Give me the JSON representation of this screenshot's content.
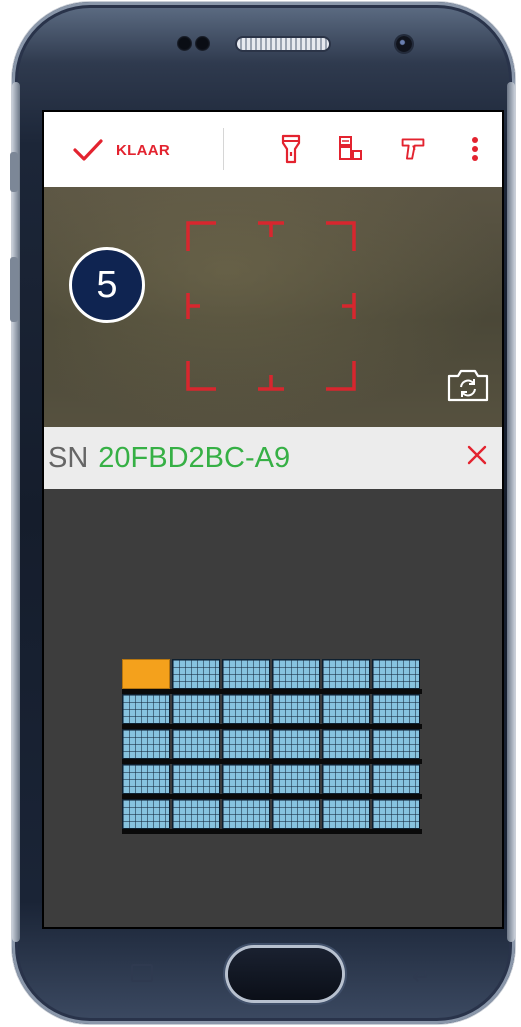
{
  "toolbar": {
    "done_label": "KLAAR",
    "icons": [
      "checkmark-icon",
      "flashlight-icon",
      "scan-mode-icon",
      "barcode-scanner-icon",
      "more-vert-icon"
    ],
    "accent": "#e3232f"
  },
  "viewfinder": {
    "step_number": "5",
    "frame_color": "#d8262e"
  },
  "serial": {
    "prefix": "SN",
    "value": "20FBD2BC-A9",
    "value_color": "#36b045"
  },
  "panel_layout": {
    "rows": 5,
    "columns": 6,
    "selected": {
      "row": 1,
      "column": 1
    },
    "panel_color": "#87c3df",
    "selected_color": "#f4a11c"
  }
}
